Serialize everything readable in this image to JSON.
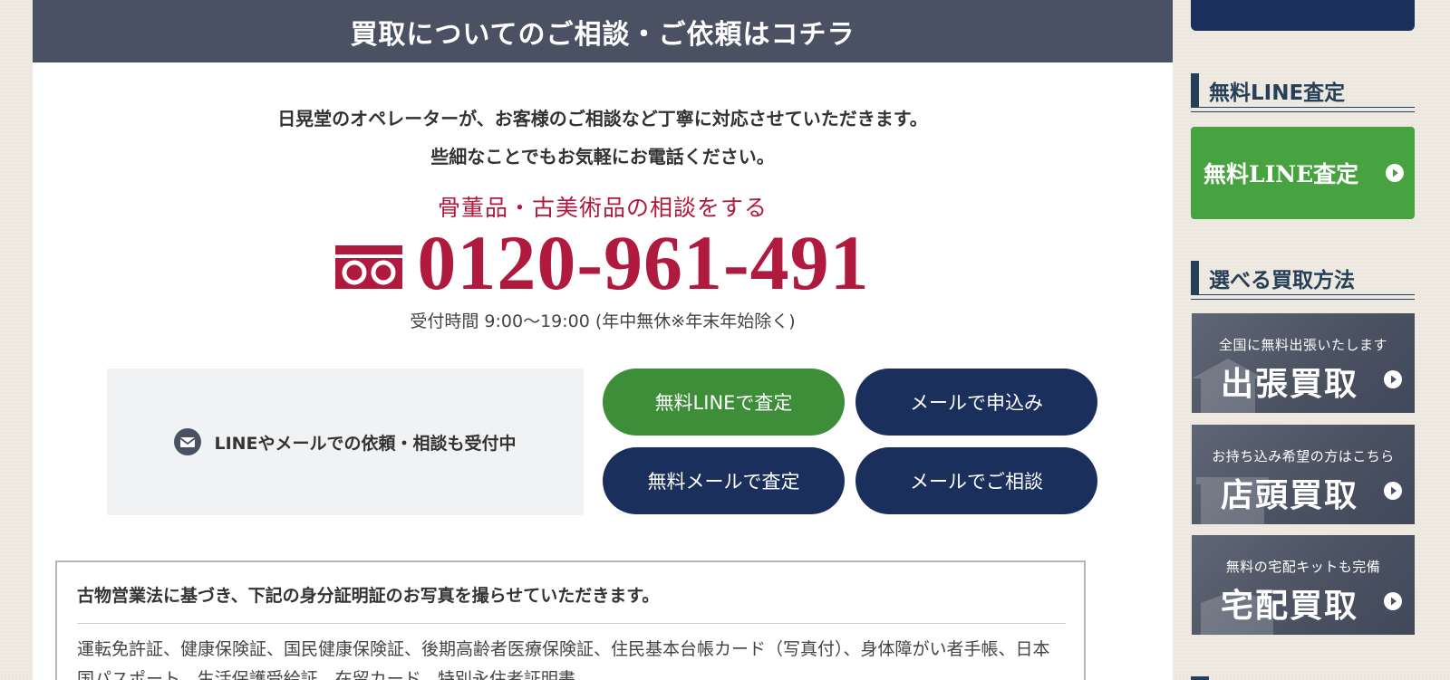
{
  "main": {
    "header_title": "買取についてのご相談・ご依頼はコチラ",
    "intro_line1": "日晃堂のオペレーターが、お客様のご相談など丁寧に対応させていただきます。",
    "intro_line2": "些細なことでもお気軽にお電話ください。",
    "consult_label": "骨董品・古美術品の相談をする",
    "phone_number": "0120-961-491",
    "hours": "受付時間 9:00〜19:00 (年中無休※年末年始除く)",
    "line_mail_notice": "LINEやメールでの依頼・相談も受付中",
    "buttons": {
      "line_appraisal": "無料LINEで査定",
      "mail_apply": "メールで申込み",
      "mail_appraisal": "無料メールで査定",
      "mail_consult": "メールでご相談"
    },
    "id_notice": {
      "title": "古物営業法に基づき、下記の身分証明証のお写真を撮らせていただきます。",
      "text": "運転免許証、健康保険証、国民健康保険証、後期高齢者医療保険証、住民基本台帳カード（写真付）、身体障がい者手帳、日本国パスポート、生活保護受給証、在留カード、特別永住者証明書"
    }
  },
  "sidebar": {
    "line_heading": "無料LINE査定",
    "line_cta": "無料LINE査定",
    "methods_heading": "選べる買取方法",
    "methods": [
      {
        "sub": "全国に無料出張いたします",
        "title": "出張買取"
      },
      {
        "sub": "お持ち込み希望の方はこちら",
        "title": "店頭買取"
      },
      {
        "sub": "無料の宅配キットも完備",
        "title": "宅配買取"
      }
    ]
  },
  "colors": {
    "header_bg": "#4a5162",
    "accent_red": "#b01a3f",
    "line_green": "#3e8d39",
    "navy": "#1b2f5d"
  },
  "icons": [
    "freedial-icon",
    "mail-icon",
    "play-circle-icon"
  ]
}
